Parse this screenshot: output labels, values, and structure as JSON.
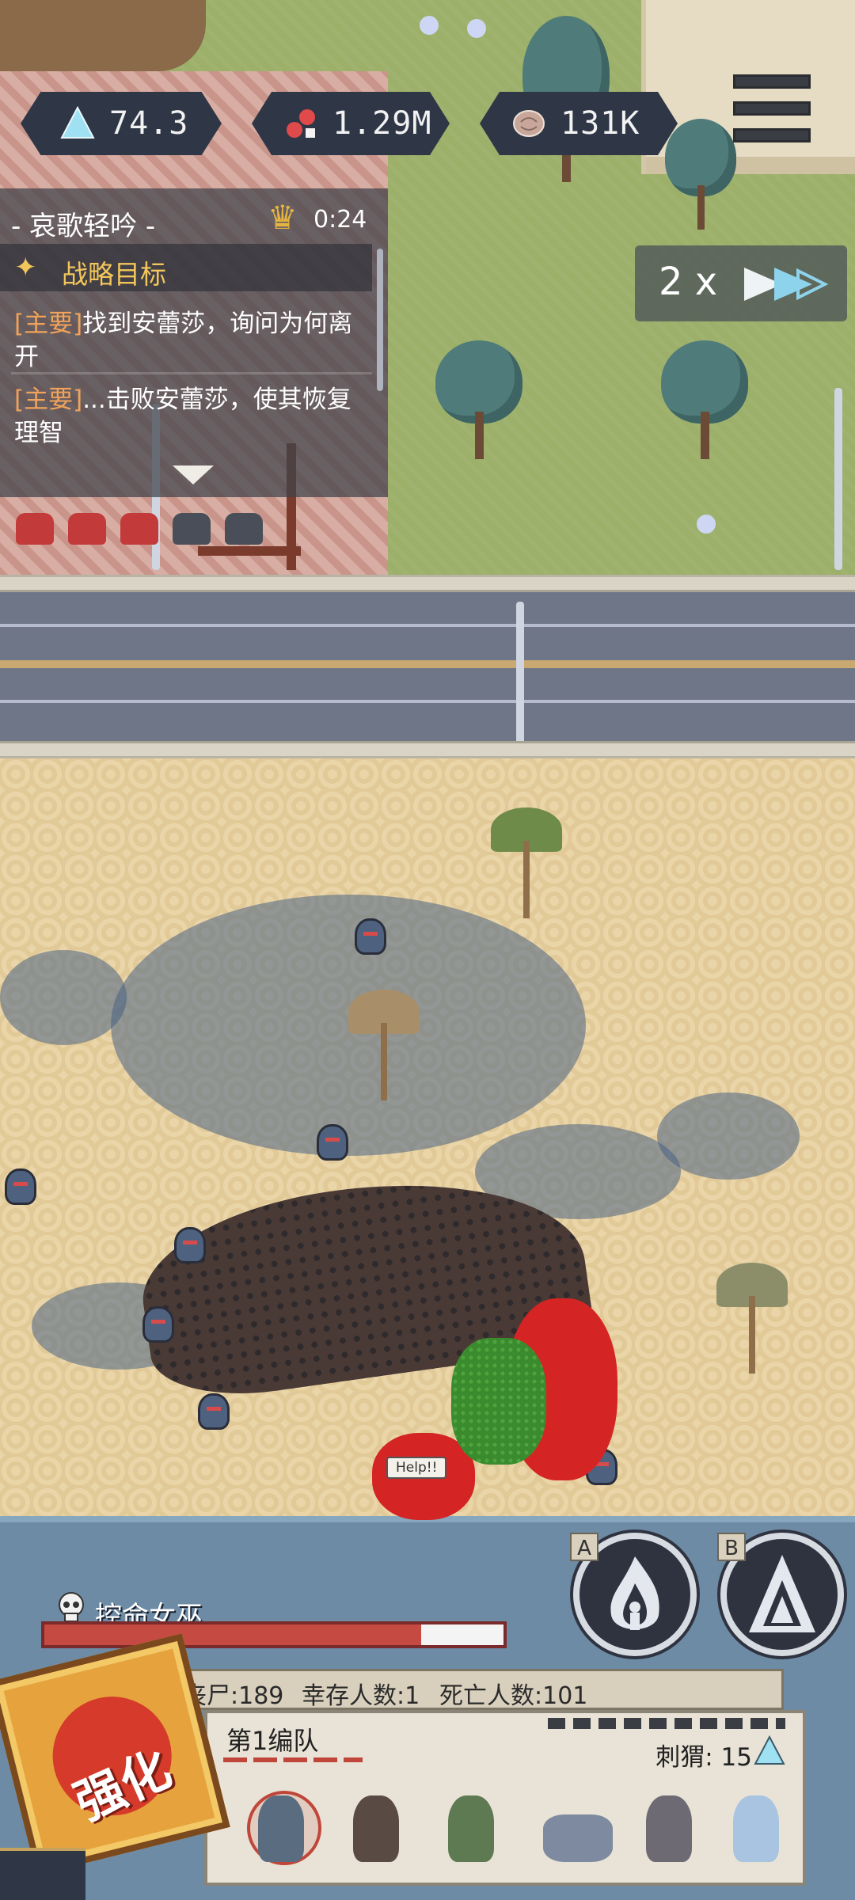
{
  "hud": {
    "resources": [
      {
        "icon": "crystal-icon",
        "value": "74.3",
        "bar_level": 0.95
      },
      {
        "icon": "blood-cells-icon",
        "value": "1.29M",
        "bar_level": 0.3
      },
      {
        "icon": "brain-icon",
        "value": "131K",
        "bar_level": 0.1
      }
    ],
    "menu_icon": "hamburger-menu-icon"
  },
  "quest": {
    "title": "- 哀歌轻吟 -",
    "timer": "0:24",
    "objectives_label": "战略目标",
    "items": [
      {
        "tag": "[主要]",
        "text": "找到安蕾莎，询问为何离开"
      },
      {
        "tag": "[主要]",
        "text": "...击败安蕾莎，使其恢复理智"
      }
    ]
  },
  "speed": {
    "label": "2 x",
    "icon": "fast-forward-icon"
  },
  "battlefield": {
    "help_bubble": "Help!!"
  },
  "boss": {
    "name": "控命女巫",
    "health": 0.82
  },
  "skills": [
    {
      "key": "A",
      "icon": "fire-skill-icon"
    },
    {
      "key": "B",
      "icon": "spike-skill-icon"
    }
  ],
  "stats": {
    "zombies": "丧尸:189",
    "survivors": "幸存人数:1",
    "dead": "死亡人数:101"
  },
  "squad": {
    "name": "第1编队",
    "cost": "刺猬: 15",
    "units": [
      {
        "icon": "zombie-unit-icon",
        "color": "#5a6c80",
        "selected": true
      },
      {
        "icon": "brute-unit-icon",
        "color": "#5a4a44"
      },
      {
        "icon": "soldier-unit-icon",
        "color": "#5e7a52"
      },
      {
        "icon": "zombie-dog-unit-icon",
        "color": "#7d8aa0"
      },
      {
        "icon": "worker-unit-icon",
        "color": "#6e6a74"
      },
      {
        "icon": "ghost-unit-icon",
        "color": "#a8c4e0"
      }
    ]
  },
  "upgrade": {
    "label": "强化"
  },
  "colors": {
    "accent_cyan": "#8ed3ec",
    "hud_dark": "#2f3747",
    "blood": "#d52424",
    "poison": "#3a8a2e"
  }
}
